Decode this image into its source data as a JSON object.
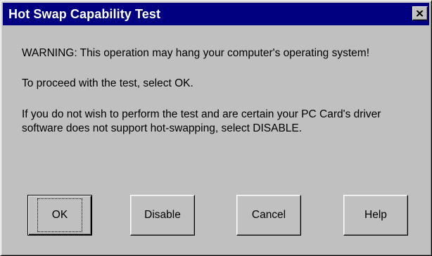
{
  "window": {
    "title": "Hot Swap Capability Test",
    "close_icon": "close-icon"
  },
  "message": {
    "warning": "WARNING:  This operation may hang your computer's operating system!",
    "proceed": "To proceed with the test, select OK.",
    "info_line1": "If you do not wish to perform the test and are certain your PC Card's driver",
    "info_line2": "software does not support hot-swapping, select DISABLE."
  },
  "buttons": {
    "ok": "OK",
    "disable": "Disable",
    "cancel": "Cancel",
    "help": "Help"
  },
  "colors": {
    "titlebar": "#000080",
    "face": "#c0c0c0"
  }
}
